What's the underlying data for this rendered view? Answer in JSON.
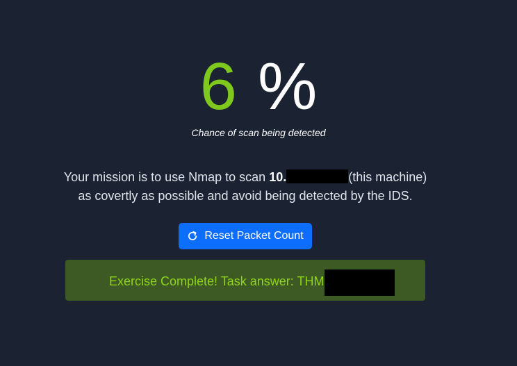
{
  "detection": {
    "value": "6",
    "unit": "%",
    "caption": "Chance of scan being detected"
  },
  "mission": {
    "prefix": "Your mission is to use Nmap to scan ",
    "ip_prefix": "10.",
    "suffix": "(this machine)",
    "line2": "as covertly as possible and avoid being detected by the IDS."
  },
  "reset_button": {
    "label": "Reset Packet Count",
    "icon": "refresh-icon"
  },
  "alert": {
    "text": "Exercise Complete! Task answer: THM"
  },
  "colors": {
    "background": "#1b2232",
    "percent_value": "#7fc81e",
    "button": "#0d6efd",
    "alert_bg": "#3d5a24",
    "alert_text": "#8fd41a"
  }
}
